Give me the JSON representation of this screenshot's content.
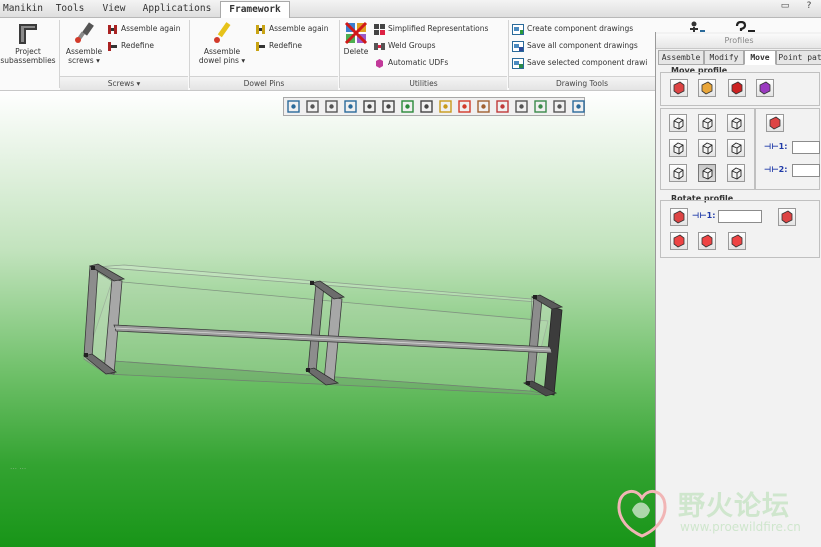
{
  "menu": {
    "tabs": [
      "Manikin",
      "Tools",
      "View",
      "Applications",
      "Framework"
    ],
    "active": "Framework"
  },
  "ribbon": {
    "project": {
      "line1": "Project",
      "line2": "subassemblies"
    },
    "screws": {
      "assemble_line1": "Assemble",
      "assemble_line2": "screws ▾",
      "assemble_again": "Assemble again",
      "redefine": "Redefine",
      "label": "Screws ▾"
    },
    "dowel": {
      "assemble_line1": "Assemble",
      "assemble_line2": "dowel pins ▾",
      "assemble_again": "Assemble again",
      "redefine": "Redefine",
      "label": "Dowel Pins"
    },
    "utilities": {
      "delete": "Delete",
      "simplified": "Simplified Representations",
      "weld": "Weld Groups",
      "udfs": "Automatic UDFs",
      "label": "Utilities"
    },
    "drawing": {
      "create": "Create component drawings",
      "save_all": "Save all component drawings",
      "save_selected": "Save selected component drawi",
      "label": "Drawing Tools"
    }
  },
  "viewport": {
    "fragment_text": "… …",
    "toolbar_icons": [
      "zoom-window-icon",
      "zoom-in-icon",
      "zoom-out-icon",
      "refit-icon",
      "view-orient-icon",
      "saved-views-icon",
      "display-style-icon",
      "model-display-icon",
      "datum-display-icon",
      "spin-center-icon",
      "plane-display-icon",
      "axis-display-icon",
      "point-display-icon",
      "csys-display-icon",
      "annotation-display-icon",
      "sketch-icon"
    ]
  },
  "panel": {
    "title": "Profiles",
    "tabs": [
      "Assemble",
      "Modify",
      "Move",
      "Point pat"
    ],
    "active_tab": "Move",
    "move_title": "Move profile",
    "offset1_label": "⊣⊢1:",
    "offset2_label": "⊣⊢2:",
    "offset1_value": "",
    "offset2_value": "",
    "rotate_title": "Rotate profile",
    "angle_label": "⊣⊢1:",
    "angle_value": ""
  },
  "watermark": {
    "cn": "野火论坛",
    "url": "www.proewildfire.cn"
  }
}
